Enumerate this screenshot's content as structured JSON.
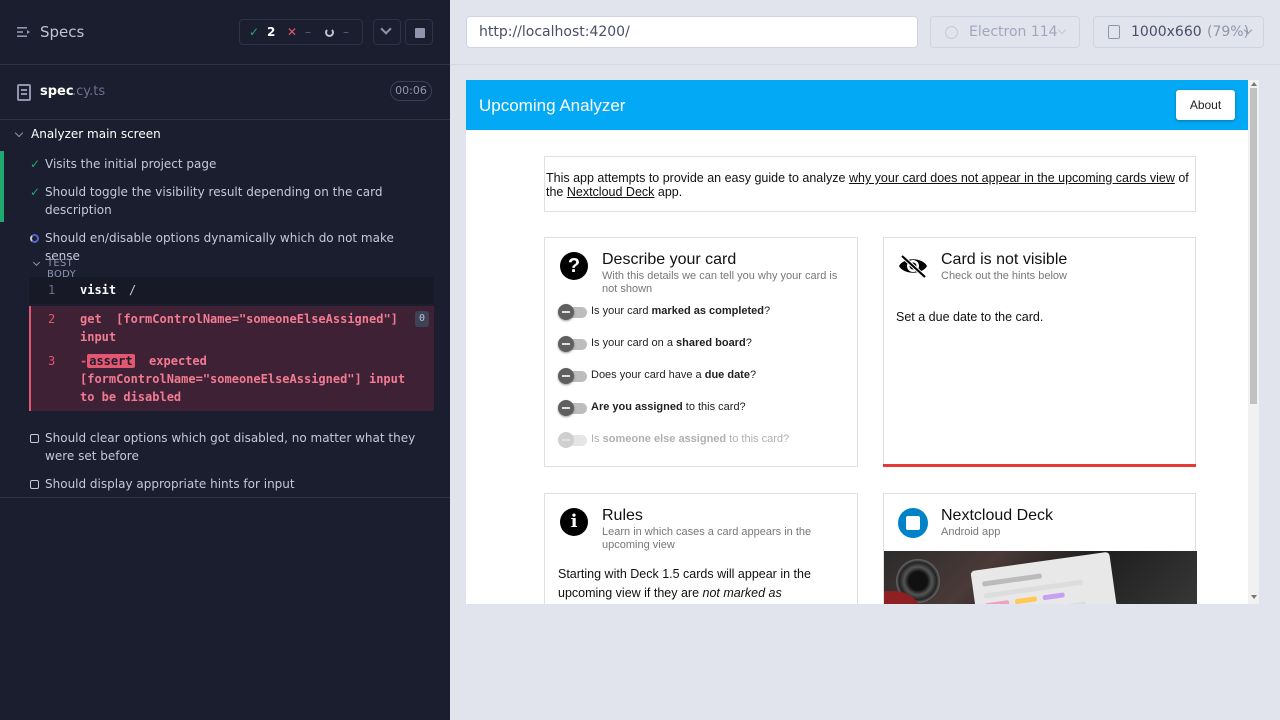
{
  "runner": {
    "header": {
      "title": "Specs",
      "passed_count": "2",
      "failed_count": "–",
      "pending_count": "–"
    },
    "spec": {
      "name": "spec",
      "ext": ".cy.ts",
      "duration": "00:06"
    },
    "suite": {
      "title": "Analyzer main screen",
      "tests": [
        {
          "title": "Visits the initial project page",
          "state": "passed"
        },
        {
          "title": "Should toggle the visibility result depending on the card description",
          "state": "passed"
        },
        {
          "title": "Should en/disable options dynamically which do not make sense",
          "state": "running"
        },
        {
          "title": "Should clear options which got disabled, no matter what they were set before",
          "state": "pending"
        },
        {
          "title": "Should display appropriate hints for input",
          "state": "pending"
        }
      ],
      "test_body_label": "TEST BODY",
      "commands": [
        {
          "num": "1",
          "name": "visit",
          "arg": "/"
        },
        {
          "num": "2",
          "name": "get",
          "arg": "[formControlName=\"someoneElseAssigned\"] input",
          "count": "0"
        },
        {
          "num": "3",
          "prefix": "-",
          "tag": "assert",
          "message": "expected [formControlName=\"someoneElseAssigned\"] input to be disabled"
        }
      ]
    }
  },
  "aut": {
    "url": "http://localhost:4200/",
    "browser": "Electron 114",
    "viewport_size": "1000x660",
    "viewport_zoom": "(79%)"
  },
  "app": {
    "toolbar_title": "Upcoming Analyzer",
    "about_label": "About",
    "intro": {
      "pre": "This app attempts to provide an easy guide to analyze ",
      "link1": "why your card does not appear in the upcoming cards view",
      "mid": " of the ",
      "link2": "Nextcloud Deck",
      "post": " app."
    },
    "describe_card": {
      "title": "Describe your card",
      "subtitle": "With this details we can tell you why your card is not shown",
      "toggles": [
        {
          "pre": "Is your card ",
          "bold": "marked as completed",
          "post": "?"
        },
        {
          "pre": "Is your card on a ",
          "bold": "shared board",
          "post": "?"
        },
        {
          "pre": "Does your card have a ",
          "bold": "due date",
          "post": "?"
        },
        {
          "pre": "",
          "bold": "Are you assigned",
          "post": " to this card?"
        },
        {
          "pre": "Is ",
          "bold": "someone else assigned",
          "post": " to this card?",
          "disabled": true
        }
      ]
    },
    "visible_card": {
      "title": "Card is not visible",
      "subtitle": "Check out the hints below",
      "body": "Set a due date to the card."
    },
    "rules_card": {
      "title": "Rules",
      "subtitle": "Learn in which cases a card appears in the upcoming view",
      "body_pre": "Starting with Deck 1.5 cards will appear in the upcoming view if they are ",
      "body_em": "not marked as"
    },
    "deck_card": {
      "title": "Nextcloud Deck",
      "subtitle": "Android app"
    }
  }
}
